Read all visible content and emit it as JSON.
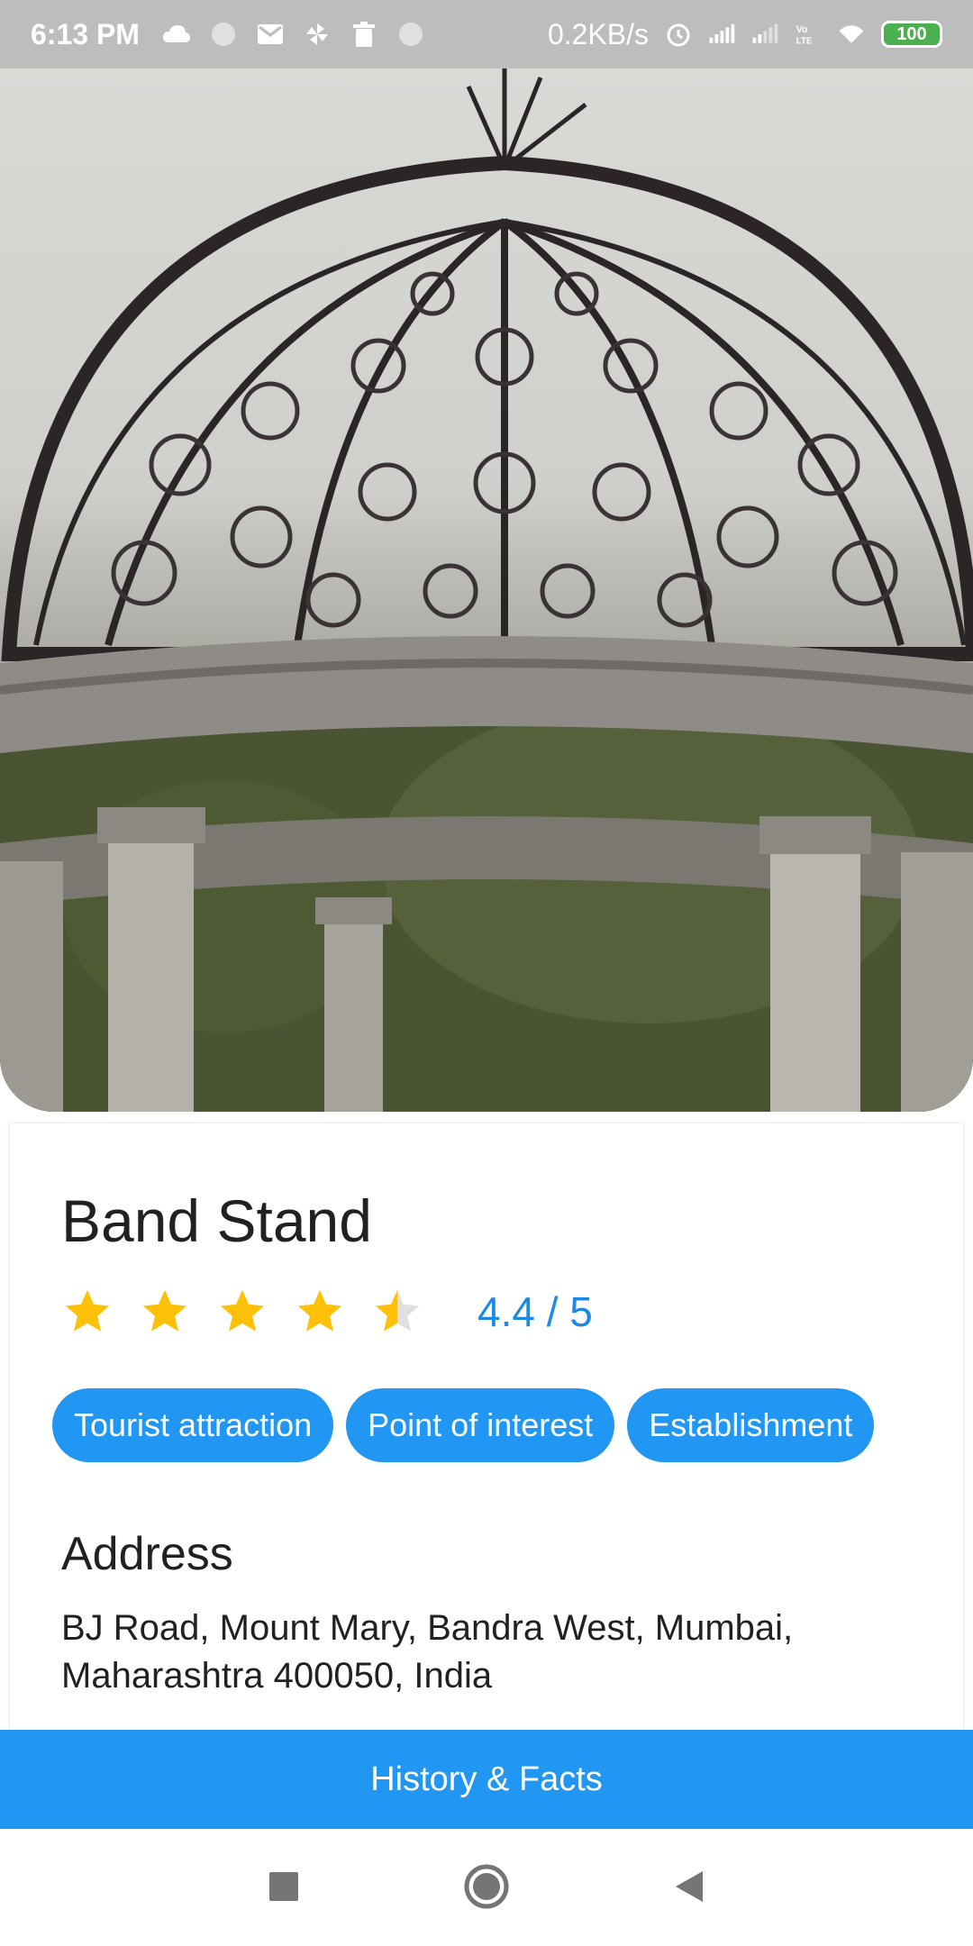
{
  "status_bar": {
    "time": "6:13 PM",
    "network_speed": "0.2KB/s",
    "battery": "100",
    "icons": [
      "cloud-icon",
      "circle-icon",
      "mail-icon",
      "pinwheel-icon",
      "trash-icon",
      "circle-icon",
      "alarm-icon",
      "signal-icon",
      "signal-icon",
      "volte-icon",
      "wifi-icon",
      "battery-icon"
    ]
  },
  "hero": {
    "image": "gazebo-photo"
  },
  "place": {
    "name": "Band Stand",
    "rating": 4.4,
    "rating_text": "4.4 / 5",
    "max_stars": 5
  },
  "tags": [
    "Tourist attraction",
    "Point of interest",
    "Establishment"
  ],
  "address_section": {
    "title": "Address",
    "text": "BJ Road, Mount Mary, Bandra West, Mumbai, Maharashtra 400050, India"
  },
  "bottom_button": {
    "label": "History & Facts"
  },
  "colors": {
    "accent": "#2196f3",
    "rating_text": "#1e88e5",
    "star": "#ffc107",
    "star_empty": "#e0e0e0"
  },
  "nav": [
    "square-icon",
    "home-circle-icon",
    "back-triangle-icon"
  ]
}
